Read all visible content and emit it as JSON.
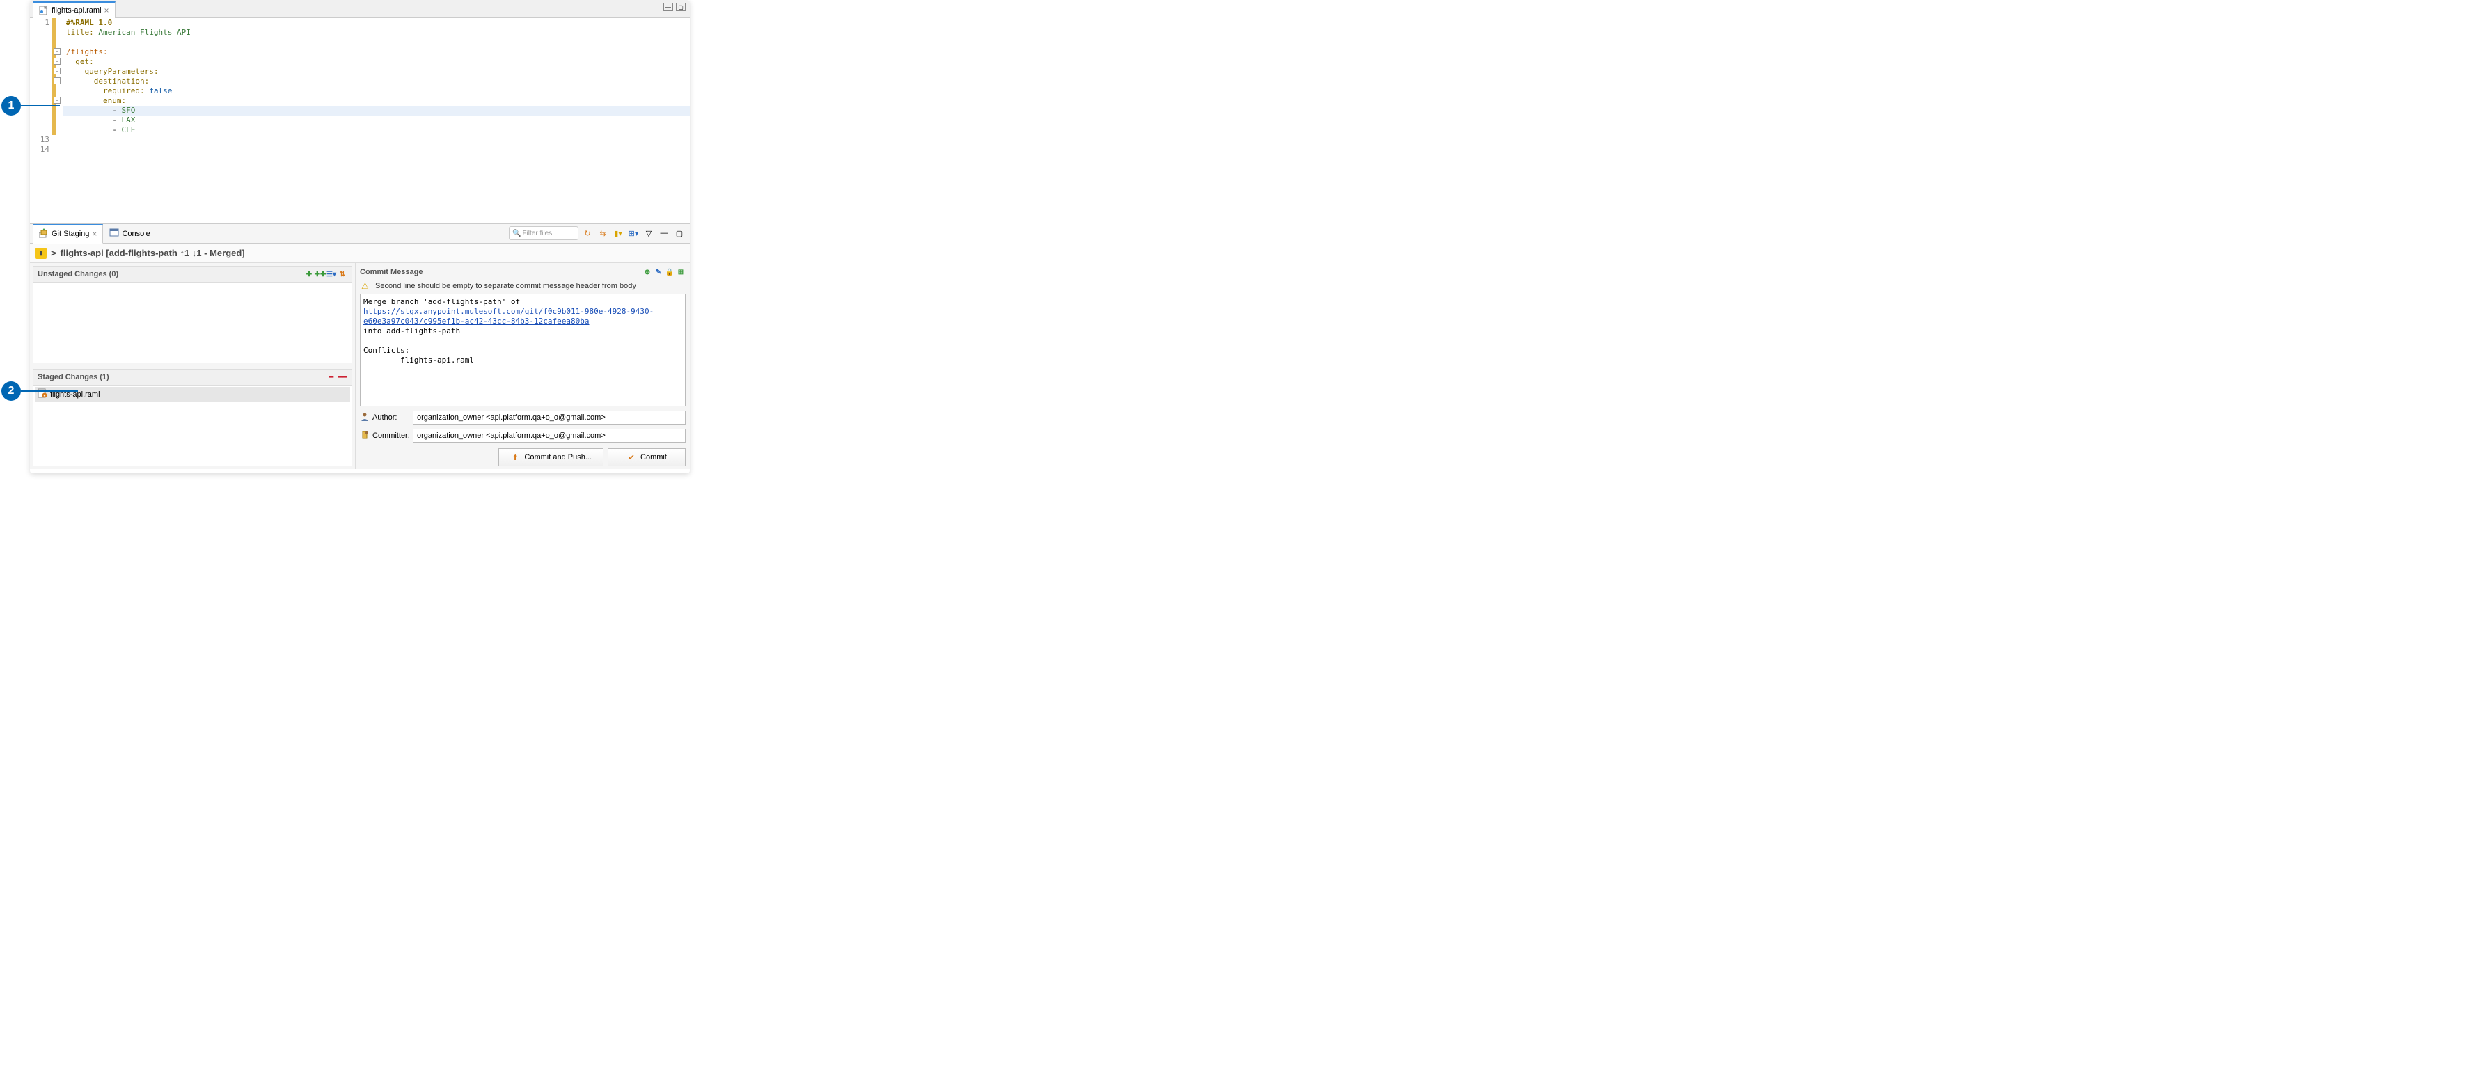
{
  "editor": {
    "tab": {
      "filename": "flights-api.raml"
    },
    "gutter": {
      "first": "1",
      "last1": "13",
      "last2": "14"
    },
    "code": {
      "l1_tag": "#%RAML 1.0",
      "l2_key": "title:",
      "l2_val": " American Flights API",
      "l4_path": "/flights:",
      "l5_key": "get:",
      "l6_key": "queryParameters:",
      "l7_key": "destination:",
      "l8_key": "required:",
      "l8_val": " false",
      "l9_key": "enum:",
      "l10_dash": "- ",
      "l10_val": "SFO",
      "l11_dash": "- ",
      "l11_val": "LAX",
      "l12_dash": "- ",
      "l12_val": "CLE"
    }
  },
  "callouts": {
    "c1": "1",
    "c2": "2"
  },
  "panel": {
    "tabs": {
      "git": "Git Staging",
      "console": "Console"
    },
    "filter_placeholder": "Filter files",
    "repo": {
      "prefix": "> ",
      "name": "flights-api [add-flights-path ↑1 ↓1 - Merged]"
    },
    "unstaged_title": "Unstaged Changes (0)",
    "staged_title": "Staged Changes (1)",
    "staged_file": "flights-api.raml",
    "commit": {
      "title": "Commit Message",
      "warn": "Second line should be empty to separate commit message header from body",
      "msg_line1": "Merge branch 'add-flights-path' of ",
      "msg_link": "https://stgx.anypoint.mulesoft.com/git/f0c9b011-980e-4928-9430-e60e3a97c043/c995ef1b-ac42-43cc-84b3-12cafeea80ba",
      "msg_line3": "into add-flights-path",
      "msg_line5": "Conflicts:",
      "msg_line6": "\tflights-api.raml",
      "author_label": "Author:",
      "committer_label": "Committer:",
      "author": "organization_owner <api.platform.qa+o_o@gmail.com>",
      "committer": "organization_owner <api.platform.qa+o_o@gmail.com>",
      "btn_push": "Commit and Push...",
      "btn_commit": "Commit"
    }
  }
}
